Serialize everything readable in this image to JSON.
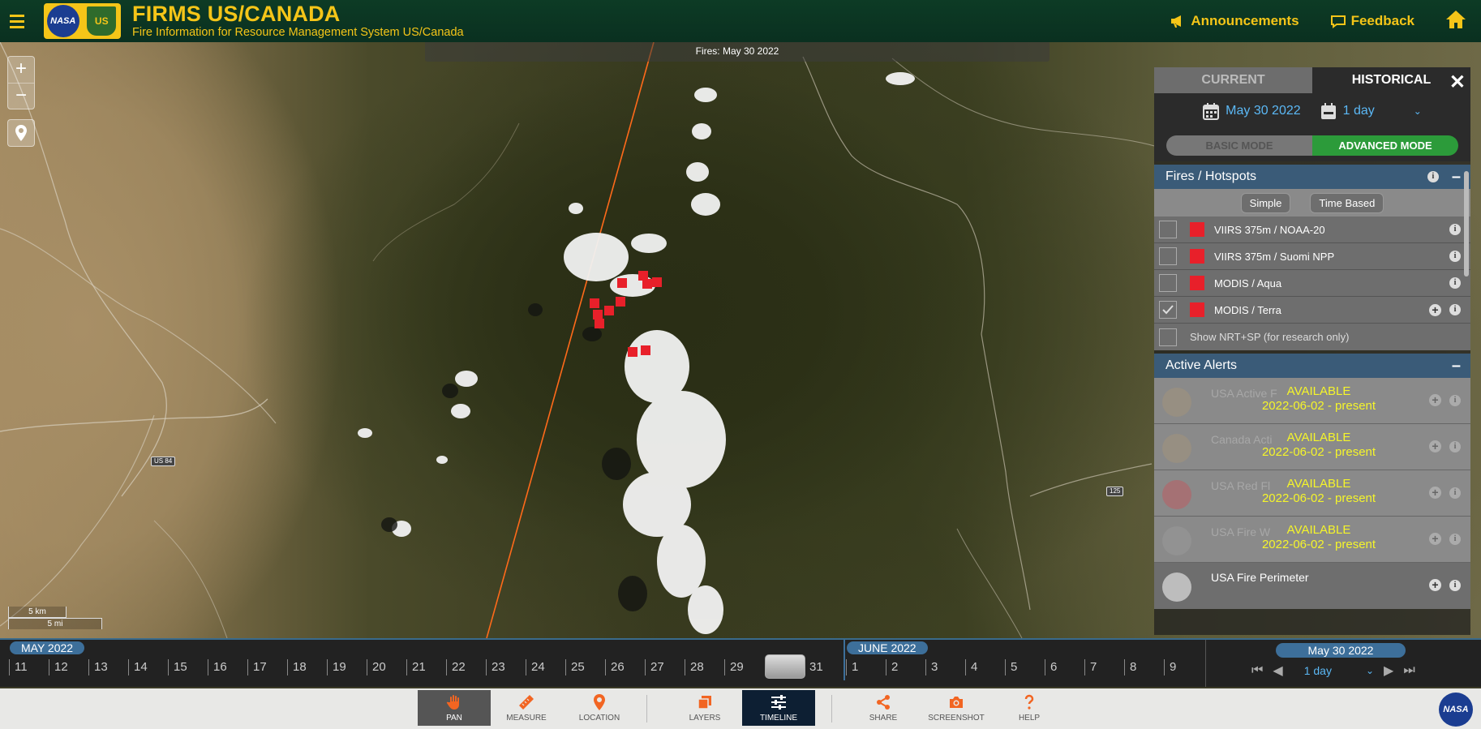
{
  "header": {
    "title": "FIRMS US/CANADA",
    "subtitle": "Fire Information for Resource Management System US/Canada",
    "nasa_logo_text": "NASA",
    "usda_logo_text": "US",
    "announcements": "Announcements",
    "feedback": "Feedback",
    "icons": [
      "menu-icon",
      "megaphone-icon",
      "chat-icon",
      "home-icon"
    ]
  },
  "map": {
    "fires_banner": "Fires: May 30 2022",
    "zoom_in": "+",
    "zoom_out": "−",
    "scale_km": "5 km",
    "scale_mi": "5 mi",
    "road_shields": [
      "US 84",
      "125"
    ]
  },
  "panel": {
    "tabs": [
      "CURRENT",
      "HISTORICAL"
    ],
    "active_tab": "HISTORICAL",
    "close": "✕",
    "date": "May 30 2022",
    "range": "1 day",
    "modes": [
      "BASIC MODE",
      "ADVANCED MODE"
    ],
    "active_mode": "ADVANCED MODE",
    "fires_section": {
      "title": "Fires / Hotspots",
      "buttons": [
        "Simple",
        "Time Based"
      ],
      "layers": [
        {
          "label": "VIIRS 375m / NOAA-20",
          "checked": false,
          "color": "#e8202a"
        },
        {
          "label": "VIIRS 375m / Suomi NPP",
          "checked": false,
          "color": "#e8202a"
        },
        {
          "label": "MODIS / Aqua",
          "checked": false,
          "color": "#e8202a"
        },
        {
          "label": "MODIS / Terra",
          "checked": true,
          "color": "#e8202a"
        }
      ],
      "nrt_label": "Show NRT+SP (for research only)"
    },
    "alerts_section": {
      "title": "Active Alerts",
      "alerts": [
        {
          "name": "USA Active F",
          "status": "AVAILABLE",
          "range": "2022-06-02 - present"
        },
        {
          "name": "Canada Acti",
          "status": "AVAILABLE",
          "range": "2022-06-02 - present"
        },
        {
          "name": "USA Red Fl",
          "status": "AVAILABLE",
          "range": "2022-06-02 - present"
        },
        {
          "name": "USA Fire W",
          "status": "AVAILABLE",
          "range": "2022-06-02 - present"
        }
      ],
      "perimeter": "USA Fire Perimeter"
    }
  },
  "timeline": {
    "month1": "MAY 2022",
    "month2": "JUNE 2022",
    "days_may": [
      "11",
      "12",
      "13",
      "14",
      "15",
      "16",
      "17",
      "18",
      "19",
      "20",
      "21",
      "22",
      "23",
      "24",
      "25",
      "26",
      "27",
      "28",
      "29",
      "30",
      "31"
    ],
    "days_june": [
      "1",
      "2",
      "3",
      "4",
      "5",
      "6",
      "7",
      "8",
      "9"
    ],
    "selected_date": "May 30 2022",
    "range": "1 day"
  },
  "toolbar": {
    "tools": [
      {
        "label": "PAN",
        "icon": "hand-icon"
      },
      {
        "label": "MEASURE",
        "icon": "ruler-icon"
      },
      {
        "label": "LOCATION",
        "icon": "pin-icon"
      },
      {
        "label": "LAYERS",
        "icon": "layers-icon"
      },
      {
        "label": "TIMELINE",
        "icon": "sliders-icon"
      },
      {
        "label": "SHARE",
        "icon": "share-icon"
      },
      {
        "label": "SCREENSHOT",
        "icon": "camera-icon"
      },
      {
        "label": "HELP",
        "icon": "question-icon"
      }
    ],
    "nasa": "NASA"
  },
  "colors": {
    "header_bg": "#0d3b25",
    "accent_yellow": "#f5c518",
    "fire_red": "#e8202a",
    "advanced_green": "#2c9b3a",
    "timeline_blue": "#3d6f9a",
    "alert_yellow": "#f5f52a"
  }
}
